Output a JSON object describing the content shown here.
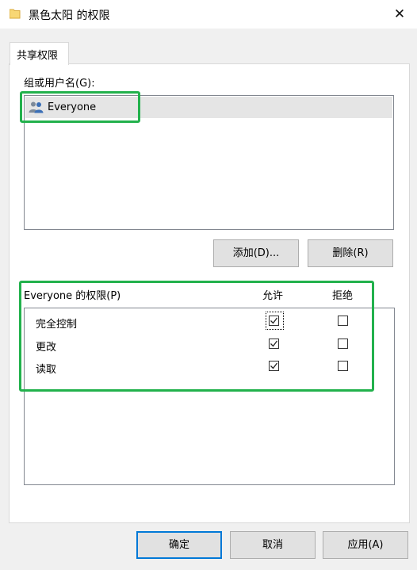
{
  "window": {
    "title": "黑色太阳 的权限",
    "close_glyph": "✕"
  },
  "tabs": [
    {
      "label": "共享权限",
      "selected": true
    }
  ],
  "groups": {
    "label": "组或用户名(G):",
    "items": [
      {
        "name": "Everyone",
        "icon": "users-icon",
        "selected": true
      }
    ]
  },
  "buttons": {
    "add": "添加(D)...",
    "remove": "删除(R)"
  },
  "permissions": {
    "header": "Everyone 的权限(P)",
    "allow_label": "允许",
    "deny_label": "拒绝",
    "rows": [
      {
        "name": "完全控制",
        "allow": true,
        "deny": false
      },
      {
        "name": "更改",
        "allow": true,
        "deny": false
      },
      {
        "name": "读取",
        "allow": true,
        "deny": false
      }
    ]
  },
  "dialog_buttons": {
    "ok": "确定",
    "cancel": "取消",
    "apply": "应用(A)"
  },
  "colors": {
    "highlight": "#22b14c",
    "default_button_border": "#0078d7"
  }
}
